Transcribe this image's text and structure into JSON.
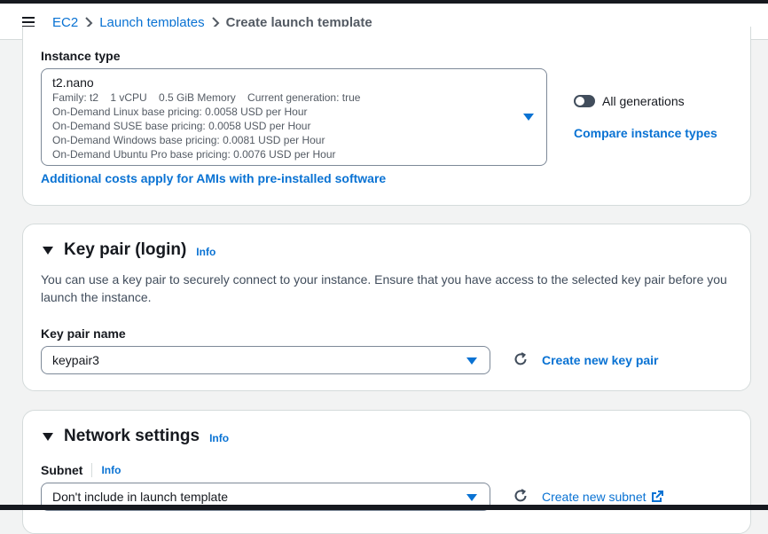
{
  "breadcrumb": {
    "items": [
      "EC2",
      "Launch templates"
    ],
    "current": "Create launch template"
  },
  "instance_type": {
    "label": "Instance type",
    "selected": "t2.nano",
    "details": "Family: t2    1 vCPU    0.5 GiB Memory    Current generation: true",
    "pricing": [
      "On-Demand Linux base pricing: 0.0058 USD per Hour",
      "On-Demand SUSE base pricing: 0.0058 USD per Hour",
      "On-Demand Windows base pricing: 0.0081 USD per Hour",
      "On-Demand Ubuntu Pro base pricing: 0.0076 USD per Hour"
    ],
    "all_generations_label": "All generations",
    "all_generations_on": false,
    "compare_link": "Compare instance types",
    "additional_costs_link": "Additional costs apply for AMIs with pre-installed software"
  },
  "key_pair": {
    "title": "Key pair (login)",
    "info": "Info",
    "description": "You can use a key pair to securely connect to your instance. Ensure that you have access to the selected key pair before you launch the instance.",
    "field_label": "Key pair name",
    "selected": "keypair3",
    "create_link": "Create new key pair"
  },
  "network": {
    "title": "Network settings",
    "info": "Info",
    "subnet_label": "Subnet",
    "subnet_info": "Info",
    "subnet_selected": "Don't include in launch template",
    "create_subnet_link": "Create new subnet"
  },
  "colors": {
    "link": "#0972d3",
    "text": "#16191f",
    "border": "#7d8998"
  }
}
